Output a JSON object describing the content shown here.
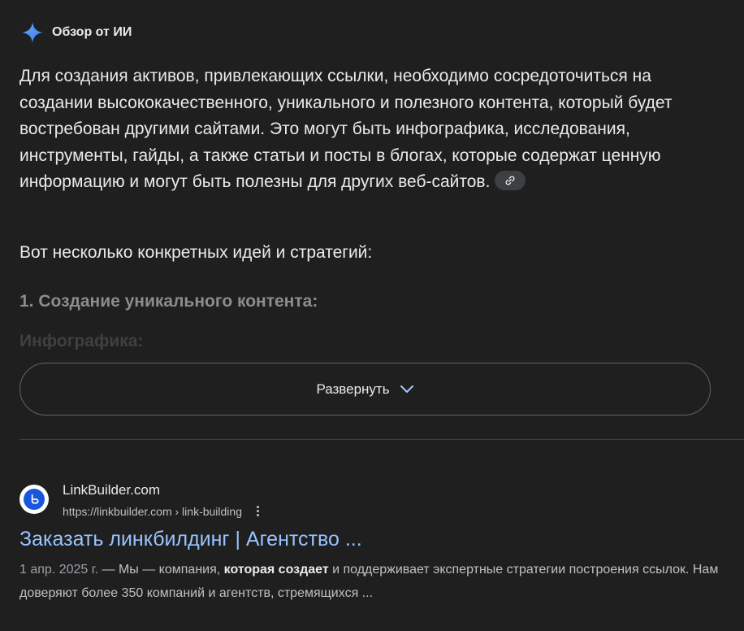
{
  "ai_overview": {
    "title": "Обзор от ИИ",
    "paragraph": "Для создания активов, привлекающих ссылки, необходимо сосредоточиться на создании высококачественного, уникального и полезного контента, который будет востребован другими сайтами. Это могут быть инфографика, исследования, инструменты, гайды, а также статьи и посты в блогах, которые содержат ценную информацию и могут быть полезны для других веб-сайтов.",
    "subtitle": "Вот несколько конкретных идей и стратегий:",
    "section_heading": "1. Создание уникального контента:",
    "section_sub": "Инфографика:",
    "expand_label": "Развернуть",
    "accent_color": "#4c8df6"
  },
  "result": {
    "site_name": "LinkBuilder.com",
    "url": "https://linkbuilder.com › link-building",
    "title": "Заказать линкбилдинг | Агентство ...",
    "snippet_date": "1 апр. 2025 г.",
    "snippet_part1": " — Мы — компания, ",
    "snippet_bold": "которая создает",
    "snippet_part2": " и поддерживает экспертные стратегии построения ссылок. Нам доверяют более 350 компаний и агентств, стремящихся ...",
    "title_color": "#99c3ff",
    "favicon_color": "#1a56db"
  }
}
